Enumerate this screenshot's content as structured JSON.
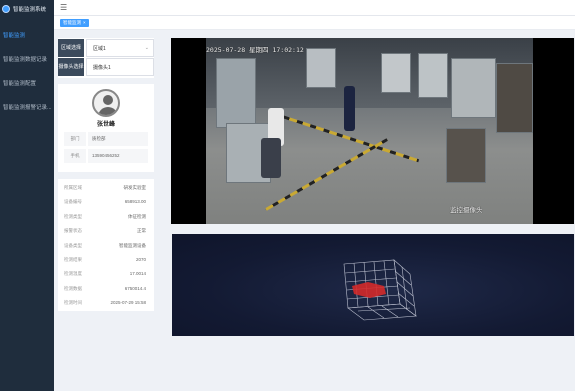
{
  "app": {
    "title": "智能监测系统"
  },
  "sidebar": {
    "items": [
      {
        "label": "智能监测",
        "active": true
      },
      {
        "label": "智能监测数据记录",
        "active": false
      },
      {
        "label": "智能监测配置",
        "active": false
      },
      {
        "label": "智能监测报警记录...",
        "active": false
      }
    ]
  },
  "tags": {
    "current": "智能监测"
  },
  "filters": {
    "area_label": "区域选择",
    "area_value": "区域1",
    "camera_label": "摄像头选择",
    "camera_value": "摄像头1"
  },
  "profile": {
    "name": "张世峰",
    "dept_label": "部门",
    "dept_value": "质检部",
    "phone_label": "手机",
    "phone_value": "13590456252"
  },
  "details": [
    {
      "key": "所属区域",
      "value": "研发实验室"
    },
    {
      "key": "设备编号",
      "value": "658913.00"
    },
    {
      "key": "检测类型",
      "value": "体征检测"
    },
    {
      "key": "报警状态",
      "value": "正常"
    },
    {
      "key": "设备类型",
      "value": "智能监测设备"
    },
    {
      "key": "检测结果",
      "value": "2070"
    },
    {
      "key": "检测温度",
      "value": "17.0014"
    },
    {
      "key": "检测数据",
      "value": "6750014.4"
    },
    {
      "key": "检测时间",
      "value": "2025-07-29 15:58"
    }
  ],
  "video": {
    "timestamp": "2025-07-28 星期四 17:02:12",
    "channel": "监控摄像头"
  },
  "colors": {
    "accent": "#409eff",
    "sidebar": "#1f2d3d",
    "label_bg": "#3b4a5c"
  }
}
